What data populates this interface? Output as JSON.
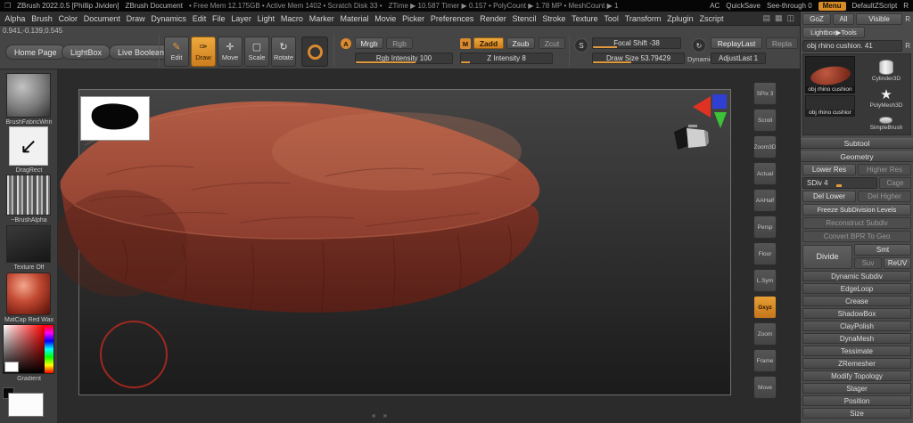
{
  "colors": {
    "accent": "#d9892f",
    "object": "#a34a36",
    "canvas_bg": "#2b2b2b"
  },
  "titlebar": {
    "app": "ZBrush 2022.0.5 [Phillip Jividen]",
    "doc": "ZBrush Document",
    "stats": "• Free Mem 12.175GB • Active Mem 1402 • Scratch Disk 33 •",
    "stats2": "ZTime ▶ 10.587 Timer ▶ 0.157 • PolyCount ▶ 1.78 MP • MeshCount ▶ 1",
    "ac": "AC",
    "quicksave": "QuickSave",
    "seethrough": "See-through 0",
    "menu": "Menu",
    "zscript": "DefaultZScript",
    "r": "R"
  },
  "menubar": {
    "items": [
      "Alpha",
      "Brush",
      "Color",
      "Document",
      "Draw",
      "Dynamics",
      "Edit",
      "File",
      "Layer",
      "Light",
      "Macro",
      "Marker",
      "Material",
      "Movie",
      "Picker",
      "Preferences",
      "Render",
      "Stencil",
      "Stroke",
      "Texture",
      "Tool",
      "Transform",
      "Zplugin",
      "Zscript"
    ],
    "icons": [
      "▤",
      "▦",
      "◫"
    ]
  },
  "toolbar": {
    "coords": "0.941,-0.139,0.545",
    "home": "Home Page",
    "lightbox": "LightBox",
    "live_boolean": "Live Boolean",
    "edit": "Edit",
    "draw": "Draw",
    "move": "Move",
    "scale": "Scale",
    "rotate": "Rotate",
    "a": "A",
    "mrgb": "Mrgb",
    "rgb": "Rgb",
    "rgb_intensity": "Rgb Intensity 100",
    "m": "M",
    "zadd": "Zadd",
    "zsub": "Zsub",
    "zcut": "Zcut",
    "z_intensity": "Z Intensity 8",
    "s": "S",
    "focal_shift": "Focal Shift -38",
    "draw_size": "Draw Size 53.79429",
    "dynamic": "Dynamic",
    "replay_last": "ReplayLast",
    "repla": "Repla",
    "adjust_last": "AdjustLast 1"
  },
  "sidebar": {
    "items": [
      {
        "label": "BrushFabricWrin"
      },
      {
        "label": "DragRect"
      },
      {
        "label": "~BrushAlpha"
      },
      {
        "label": "Texture Off"
      },
      {
        "label": "MatCap Red Wax"
      },
      {
        "label": "Gradient"
      }
    ]
  },
  "strip": {
    "items": [
      "SPix 3",
      "Scroll",
      "Zoom3D",
      "Actual",
      "AAHalf",
      "Persp",
      "Floor",
      "L.Sym",
      "Gxyz",
      "Zoom",
      "Frame",
      "Move"
    ]
  },
  "canvas": {
    "nav": "«  »"
  },
  "panel": {
    "goz": "GoZ",
    "all": "All",
    "visible": "Visible",
    "r": "R",
    "lightbox_tools": "Lightbox▶Tools",
    "tool_bar": "obj rhino cushion. 41",
    "active_tool": "obj rhino cushion",
    "history_tool": "obj rhino cushior",
    "cylinder": "Cylinder3D",
    "polymesh": "PolyMesh3D",
    "simplebrush": "SimpleBrush",
    "subtool": "Subtool",
    "geometry": "Geometry",
    "lower_res": "Lower Res",
    "higher_res": "Higher Res",
    "sdiv": "SDiv 4",
    "cage": "Cage",
    "del_lower": "Del Lower",
    "del_higher": "Del Higher",
    "freeze": "Freeze SubDivision Levels",
    "reconstruct": "Reconstruct Subdiv",
    "convert": "Convert BPR To Geo",
    "divide": "Divide",
    "smt": "Smt",
    "suv": "Suv",
    "reuv": "ReUV",
    "sections": [
      "Dynamic Subdiv",
      "EdgeLoop",
      "Crease",
      "ShadowBox",
      "ClayPolish",
      "DynaMesh",
      "Tessimate",
      "ZRemesher",
      "Modify Topology",
      "Stager",
      "Position",
      "Size"
    ]
  }
}
